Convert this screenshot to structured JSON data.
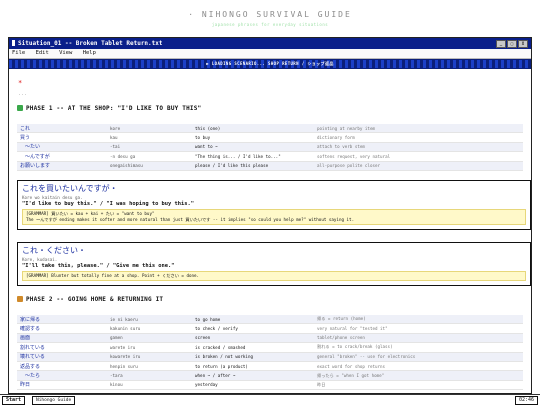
{
  "page": {
    "site_title": "· NIHONGO SURVIVAL GUIDE",
    "site_subtitle": "japanese phrases for everyday situations"
  },
  "window": {
    "title": "Situation_01 -- Broken Tablet Return.txt",
    "controls": [
      "_",
      "□",
      "X"
    ],
    "menu": [
      "File",
      "Edit",
      "View",
      "Help"
    ],
    "marquee": "▶ LOADING SCENARIO... SHOP RETURN / ショップ返品"
  },
  "content": {
    "star": "*",
    "dots": "...",
    "phase1": {
      "icon": "cart-icon",
      "title": "PHASE 1 -- AT THE SHOP: \"I'D LIKE TO BUY THIS\""
    },
    "phase1_rows": [
      {
        "jp": "これ",
        "ro": "kore",
        "en": "this (one)",
        "note": "pointing at nearby item"
      },
      {
        "jp": "買う",
        "ro": "kau",
        "en": "to buy",
        "note": "dictionary form"
      },
      {
        "jp": "　〜たい",
        "ro": "-tai",
        "en": "want to ~",
        "note": "attach to verb stem"
      },
      {
        "jp": "　〜んですが",
        "ro": "-n desu ga",
        "en": "\"The thing is... / I'd like to...\"",
        "note": "softens request, very natural"
      },
      {
        "jp": "お願いします",
        "ro": "onegaishimasu",
        "en": "please / I'd like this please",
        "note": "all-purpose polite closer"
      }
    ],
    "card1": {
      "jp": "これを買いたいんですが・",
      "romaji": "Kore wo kaitain desu ga.",
      "english": "\"I'd like to buy this.\" / \"I was hoping to buy this.\"",
      "grammar_1": "[GRAMMAR] 買いたい = kau + kai + たい = \"want to buy\"",
      "grammar_2": "The 〜んですが ending makes it softer and more natural than just 買いたいです -- it implies \"so could you help me?\" without saying it."
    },
    "card2": {
      "jp": "これ・ください・",
      "romaji": "Kore, kudasai.",
      "english": "\"I'll take this, please.\" / \"Give me this one.\"",
      "grammar_1": "[GRAMMAR] Blunter but totally fine at a shop. Point + ください = done."
    },
    "phase2": {
      "icon": "box-icon",
      "title": "PHASE 2 -- GOING HOME & RETURNING IT"
    },
    "phase2_rows": [
      {
        "jp": "家に帰る",
        "ro": "ie ni kaeru",
        "en": "to go home",
        "note": "帰る = return (home)"
      },
      {
        "jp": "確認する",
        "ro": "kakunin suru",
        "en": "to check / verify",
        "note": "very natural for \"tested it\""
      },
      {
        "jp": "画面",
        "ro": "gamen",
        "en": "screen",
        "note": "tablet/phone screen"
      },
      {
        "jp": "割れている",
        "ro": "warete iru",
        "en": "is cracked / smashed",
        "note": "割れる = to crack/break (glass)"
      },
      {
        "jp": "壊れている",
        "ro": "kowarete iru",
        "en": "is broken / not working",
        "note": "general \"broken\" -- use for electronics"
      },
      {
        "jp": "返品する",
        "ro": "henpin suru",
        "en": "to return (a product)",
        "note": "exact word for shop returns"
      },
      {
        "jp": "　〜たら",
        "ro": "-tara",
        "en": "when ~ / after ~",
        "note": "帰ったら = \"when I got home\""
      },
      {
        "jp": "昨日",
        "ro": "kinou",
        "en": "yesterday",
        "note": "昨日"
      }
    ]
  },
  "taskbar": {
    "start": "Start",
    "task": "Nihongo Guide",
    "clock": "02:46"
  },
  "colors": {
    "titlebar": "#0a1f8a",
    "marquee": "#1b3fc7",
    "japanese_text": "#1b2fa0",
    "grammar_bg": "#fff9c9",
    "phase1_icon": "#3aa84a",
    "phase2_icon": "#d08a2a"
  }
}
